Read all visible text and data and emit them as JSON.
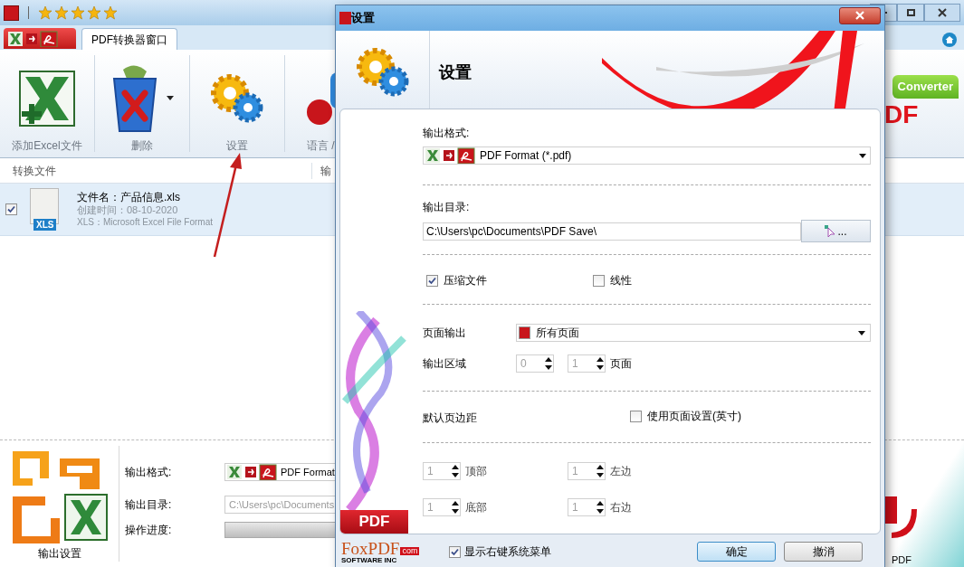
{
  "main": {
    "stars": 5,
    "tab": {
      "label": "PDF转换器窗口",
      "selected": true
    },
    "toolbar": [
      {
        "kind": "excel",
        "label": "添加Excel文件"
      },
      {
        "kind": "trash",
        "label": "删除",
        "dropdown": true
      },
      {
        "kind": "gears",
        "label": "设置"
      },
      {
        "kind": "letters",
        "label": "语言 /"
      }
    ],
    "brand": {
      "badge": "Converter",
      "logo": "DF"
    },
    "columns": [
      "转换文件",
      "输"
    ],
    "files": [
      {
        "checked": true,
        "selected": true,
        "badge": "XLS",
        "name": "文件名：产品信息.xls",
        "created": "创建时间：08-10-2020",
        "type": "XLS：Microsoft Excel File Format"
      }
    ],
    "output": {
      "title": "输出设置",
      "format_label": "输出格式:",
      "format": "PDF Format",
      "dir_label": "输出目录:",
      "dir": "C:\\Users\\pc\\Documents",
      "progress_label": "操作进度:",
      "progress": {
        "level": 0
      }
    },
    "corner_label": "PDF"
  },
  "dialog": {
    "title": "设置",
    "heading": "设置",
    "format_label": "输出格式:",
    "format": "PDF Format (*.pdf)",
    "dir_label": "输出目录:",
    "dir": "C:\\Users\\pc\\Documents\\PDF Save\\",
    "browse": "...",
    "options": [
      {
        "label": "压缩文件",
        "checked": true
      },
      {
        "label": "线性",
        "checked": false
      }
    ],
    "page_output_label": "页面输出",
    "page_output": "所有页面",
    "range_label": "输出区域",
    "range": [
      {
        "value": "0",
        "disabled": true
      },
      {
        "value": "1",
        "disabled": true
      }
    ],
    "range_unit": "页面",
    "margin_label": "默认页边距",
    "use_page_setup": {
      "label": "使用页面设置(英寸)",
      "checked": false
    },
    "margins": [
      {
        "value": "1",
        "label": "顶部",
        "disabled": true
      },
      {
        "value": "1",
        "label": "左边",
        "disabled": true
      },
      {
        "value": "1",
        "label": "底部",
        "disabled": true
      },
      {
        "value": "1",
        "label": "右边",
        "disabled": true
      }
    ],
    "side_label": "PDF",
    "logo": {
      "name": "FoxPDF",
      "suffix": "com",
      "tagline": "SOFTWARE INC"
    },
    "context_menu": {
      "label": "显示右键系统菜单",
      "checked": true
    },
    "buttons": [
      {
        "label": "确定",
        "kind": "primary"
      },
      {
        "label": "撤消",
        "kind": "secondary"
      }
    ]
  }
}
